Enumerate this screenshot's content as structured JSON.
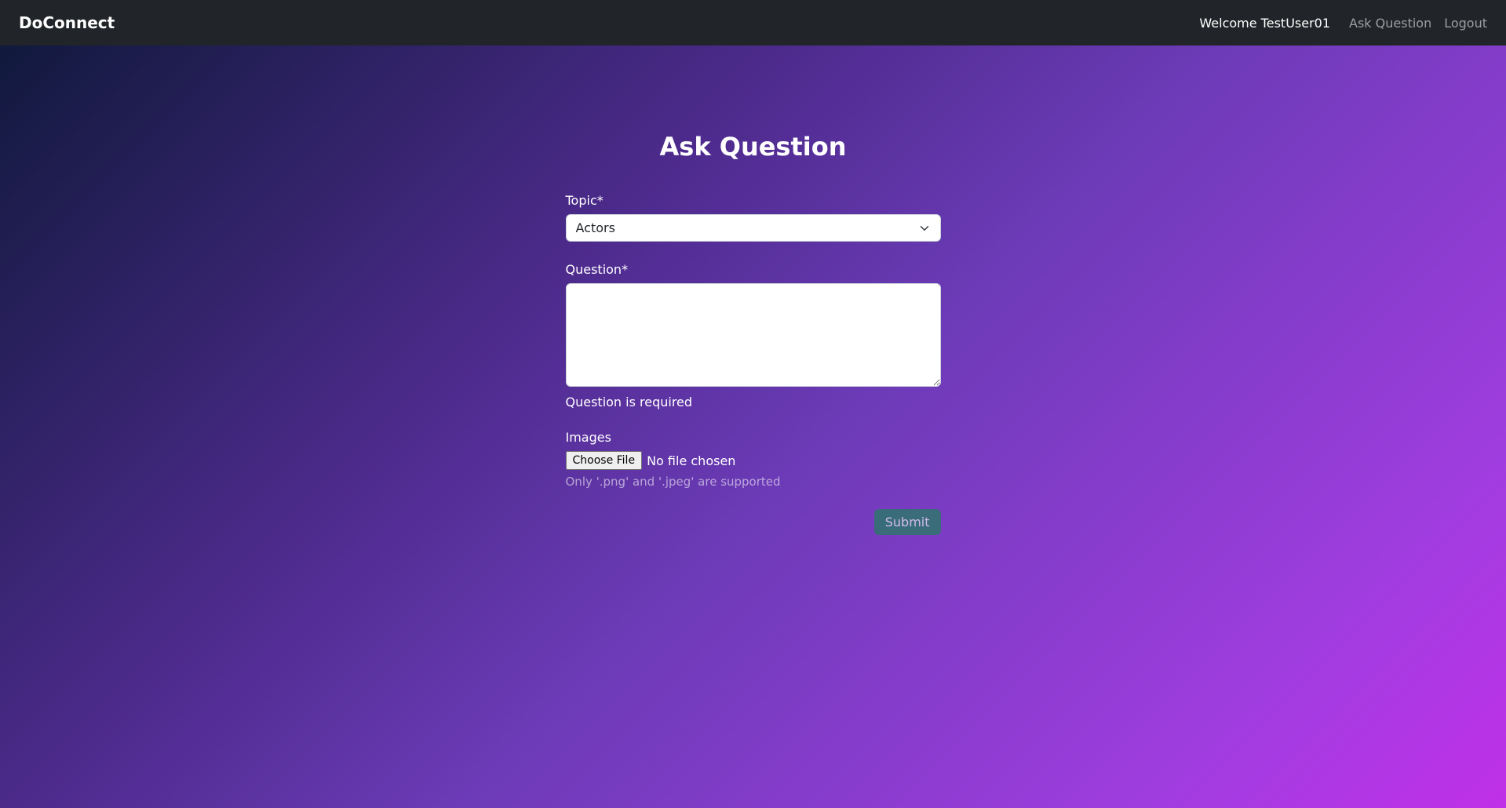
{
  "navbar": {
    "brand": "DoConnect",
    "welcome": "Welcome TestUser01",
    "ask_question": "Ask Question",
    "logout": "Logout"
  },
  "page": {
    "title": "Ask Question"
  },
  "form": {
    "topic_label": "Topic*",
    "topic_selected": "Actors",
    "question_label": "Question*",
    "question_value": "",
    "question_error": "Question is required",
    "images_label": "Images",
    "choose_file_label": "Choose File",
    "file_status": "No file chosen",
    "file_helper": "Only '.png' and '.jpeg' are supported",
    "submit_label": "Submit"
  }
}
